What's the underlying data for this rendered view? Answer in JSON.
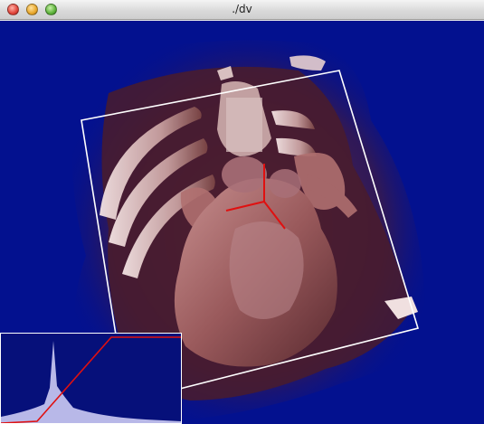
{
  "window": {
    "title": "./dv"
  },
  "colors": {
    "background": "#03118f",
    "volume_tint": "#8a4444",
    "bounding_box": "#ffffff",
    "axes": "#e01010",
    "transfer_function": "#e01010",
    "histogram_fill": "#b8b8e8"
  },
  "icons": {
    "close": "close-icon",
    "minimize": "minimize-icon",
    "zoom": "zoom-icon"
  }
}
